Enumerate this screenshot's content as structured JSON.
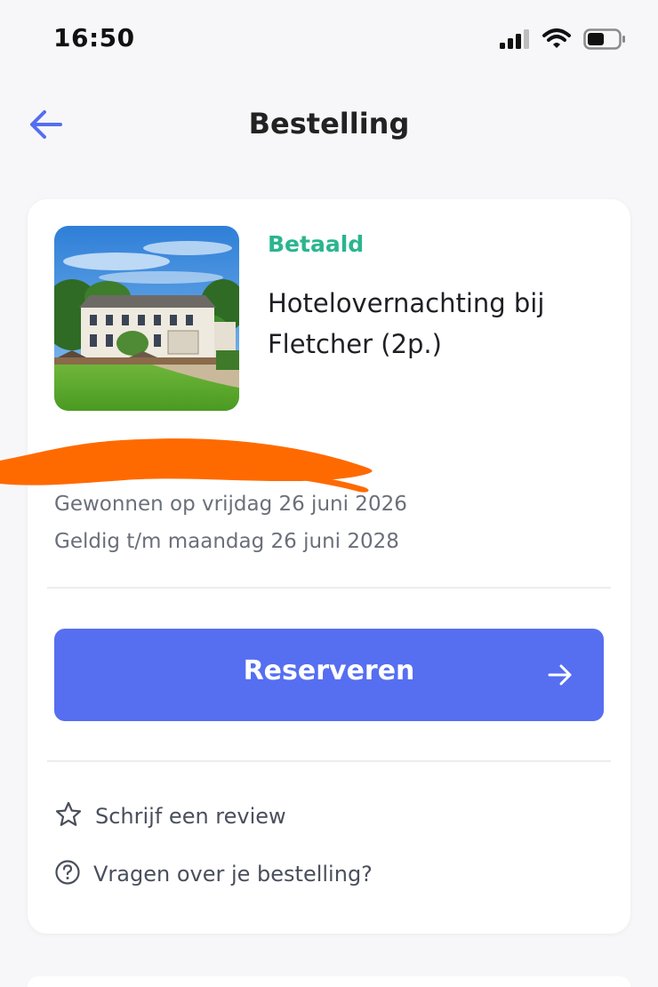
{
  "status_bar": {
    "time": "16:50"
  },
  "header": {
    "title": "Bestelling",
    "back_icon": "arrow-left-icon"
  },
  "order": {
    "status": "Betaald",
    "title": "Hotelovernachting bij Fletcher (2p.)",
    "won_on": "Gewonnen op vrijdag 26 juni 2026",
    "valid_until": "Geldig t/m maandag 26 juni 2028"
  },
  "actions": {
    "reserve_label": "Reserveren",
    "review_label": "Schrijf een review",
    "questions_label": "Vragen over je bestelling?"
  },
  "colors": {
    "accent": "#566ef0",
    "paid_status": "#2bb58f",
    "redaction": "#ff6a00",
    "background": "#f7f7f9"
  }
}
